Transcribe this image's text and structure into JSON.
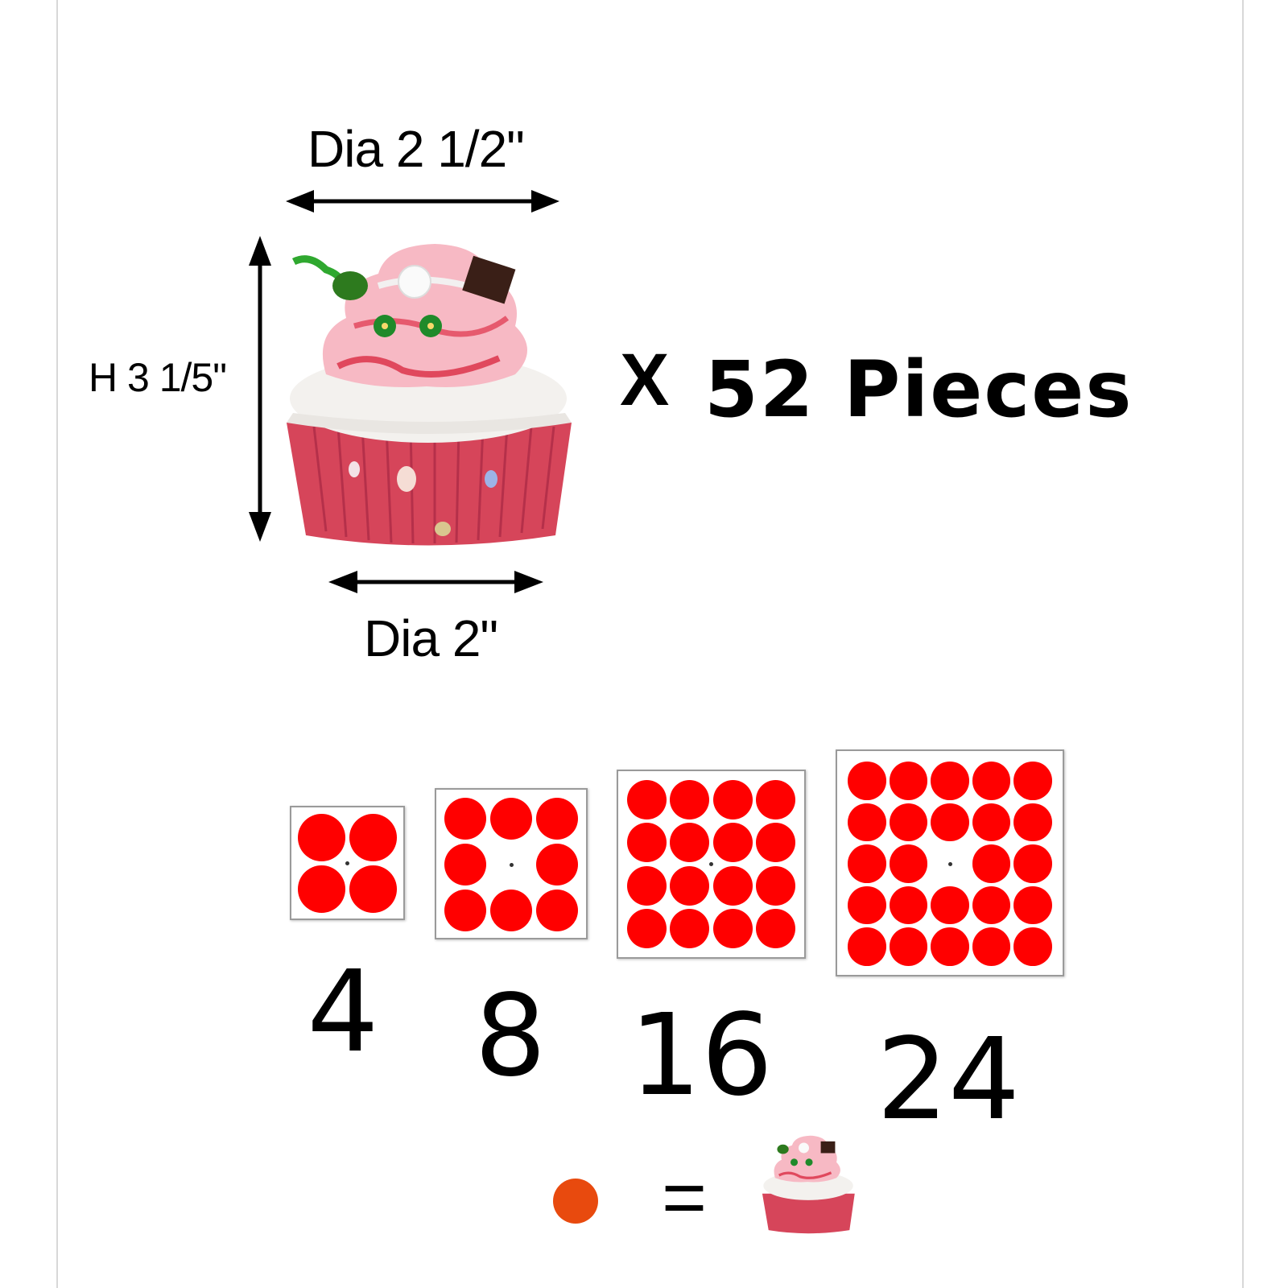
{
  "dimensions": {
    "top_diameter": "Dia 2 1/2\"",
    "height": "H 3 1/5\"",
    "bottom_diameter": "Dia 2\""
  },
  "quantity": {
    "prefix": "X",
    "label": "52 Pieces"
  },
  "packs": [
    {
      "count": "4",
      "dots_per_row": 2,
      "rows": 2,
      "missing_center": false
    },
    {
      "count": "8",
      "dots_per_row": 3,
      "rows": 3,
      "missing_center": true
    },
    {
      "count": "16",
      "dots_per_row": 4,
      "rows": 4,
      "missing_center": false
    },
    {
      "count": "24",
      "dots_per_row": 5,
      "rows": 5,
      "missing_center": true
    }
  ],
  "legend": {
    "equals": "="
  },
  "colors": {
    "dot": "#ff0000",
    "legend_dot": "#e84a0e",
    "cupcake_liner": "#d6455a",
    "frosting": "#f7b9c4"
  }
}
